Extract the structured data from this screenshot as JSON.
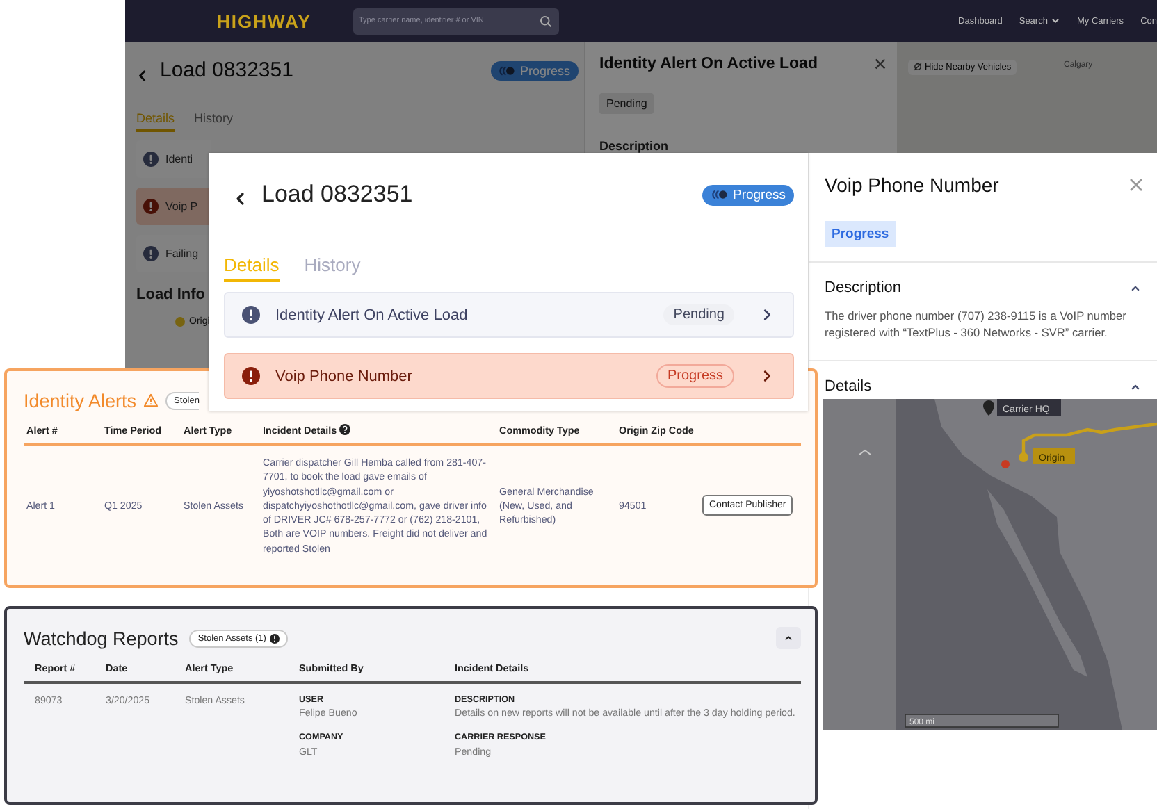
{
  "background_app": {
    "logo": "HIGHWAY",
    "search": {
      "placeholder": "Type carrier name, identifier # or VIN"
    },
    "nav": [
      {
        "label": "Dashboard",
        "dropdown": false
      },
      {
        "label": "Search",
        "dropdown": true
      },
      {
        "label": "My Carriers",
        "dropdown": false
      },
      {
        "label": "Con",
        "dropdown": false
      }
    ],
    "load_title": "Load 0832351",
    "status": "Progress",
    "tabs": [
      {
        "label": "Details",
        "selected": true
      },
      {
        "label": "History",
        "selected": false
      }
    ],
    "alerts": [
      {
        "label": "Identi",
        "kind": "info"
      },
      {
        "label": "Voip P",
        "kind": "danger"
      },
      {
        "label": "Failing",
        "kind": "info"
      }
    ],
    "section_title": "Load Info",
    "origin_label": "Origi",
    "detail_panel": {
      "title": "Identity Alert On Active Load",
      "status": "Pending",
      "section": "Description"
    },
    "map": {
      "button": "Hide Nearby Vehicles",
      "city": "Calgary"
    }
  },
  "load_panel": {
    "title": "Load 0832351",
    "status": "Progress",
    "tabs": [
      {
        "label": "Details",
        "selected": true
      },
      {
        "label": "History",
        "selected": false
      }
    ],
    "alerts": [
      {
        "label": "Identity Alert On Active Load",
        "kind": "info",
        "status": "Pending"
      },
      {
        "label": "Voip Phone Number",
        "kind": "danger",
        "status": "Progress"
      }
    ]
  },
  "alert_panel": {
    "title": "Voip Phone Number",
    "status": "Progress",
    "sections": [
      {
        "title": "Description",
        "expanded": true,
        "text": "The driver phone number (707) 238-9115 is a VoIP number registered with “TextPlus - 360 Networks - SVR” carrier."
      },
      {
        "title": "Details",
        "expanded": true
      }
    ],
    "map": {
      "hq_label": "Carrier HQ",
      "origin_label": "Origin",
      "scale": "500 mi"
    }
  },
  "identity_alerts": {
    "title": "Identity Alerts",
    "chip": "Stolen",
    "columns": [
      "Alert #",
      "Time Period",
      "Alert Type",
      "Incident Details",
      "Commodity Type",
      "Origin Zip Code"
    ],
    "rows": [
      {
        "cells": [
          "Alert 1",
          "Q1 2025",
          "Stolen Assets",
          "Carrier dispatcher Gill Hemba called from 281-407-7701, to book the load gave emails of yiyoshotshotllc@gmail.com or dispatchyiyoshothotllc@gmail.com, gave driver info of DRIVER JC# 678-257-7772 or (762) 218-2101, Both are VOIP numbers. Freight did not deliver and reported Stolen",
          "General Merchandise (New, Used, and Refurbished)",
          "94501"
        ],
        "action": "Contact Publisher"
      }
    ]
  },
  "watchdog_reports": {
    "title": "Watchdog Reports",
    "chip": "Stolen Assets (1)",
    "expanded": true,
    "columns": [
      "Report #",
      "Date",
      "Alert Type",
      "Submitted By",
      "Incident Details"
    ],
    "rows": [
      {
        "report": "89073",
        "date": "3/20/2025",
        "alert_type": "Stolen Assets",
        "submitted_by": [
          {
            "label": "USER",
            "value": "Felipe Bueno"
          },
          {
            "label": "COMPANY",
            "value": "GLT"
          }
        ],
        "incident": [
          {
            "label": "DESCRIPTION",
            "value": "Details on new reports will not be available until after the 3 day holding period."
          },
          {
            "label": "CARRIER RESPONSE",
            "value": "Pending"
          }
        ]
      }
    ]
  }
}
